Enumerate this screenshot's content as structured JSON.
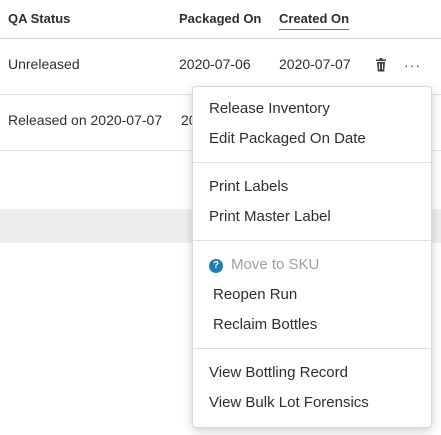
{
  "table": {
    "headers": {
      "qa_status": "QA Status",
      "packaged_on": "Packaged On",
      "created_on": "Created On"
    },
    "rows": [
      {
        "qa_status": "Unreleased",
        "packaged_on": "2020-07-06",
        "created_on": "2020-07-07"
      },
      {
        "qa_status": "Released on 2020-07-07",
        "packaged_on_partial": "20"
      }
    ]
  },
  "row_actions": {
    "delete_icon": "trash-icon",
    "more_icon": "more-horizontal-icon",
    "more_glyph": "···"
  },
  "menu": {
    "release_inventory": "Release Inventory",
    "edit_packaged_on_date": "Edit Packaged On Date",
    "print_labels": "Print Labels",
    "print_master_label": "Print Master Label",
    "help_glyph": "?",
    "move_to_sku": "Move to SKU",
    "reopen_run": "Reopen Run",
    "reclaim_bottles": "Reclaim Bottles",
    "view_bottling_record": "View Bottling Record",
    "view_bulk_lot_forensics": "View Bulk Lot Forensics"
  },
  "colors": {
    "accent_help": "#1f7fb2",
    "text": "#2b2f33",
    "disabled_text": "#9aa0a6",
    "band": "#eceef0"
  }
}
